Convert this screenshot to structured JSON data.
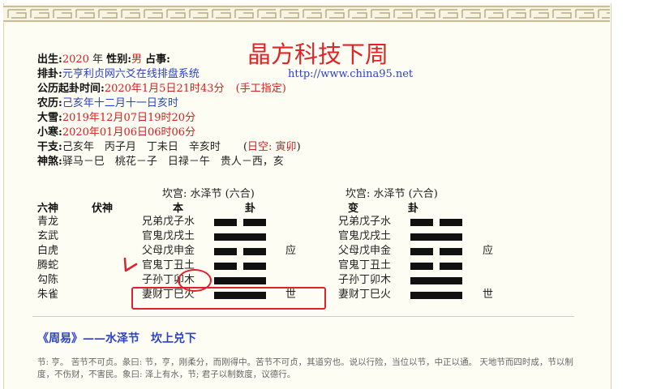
{
  "overlay_title": "晶方科技下周",
  "info": {
    "birth_label": "出生:",
    "birth_year": "2020",
    "year_unit": "年",
    "gender_label": "性别:",
    "gender": "男",
    "matter_label": "占事:",
    "paigua_label": "排卦:",
    "system_name": "元亨利贞网六爻在线排盘系统",
    "url": "http://www.china95.net",
    "time_label": "公历起卦时间:",
    "time_value": "2020年1月5日21时43分",
    "time_note": "(手工指定)",
    "lunar_label": "农历:",
    "lunar_value": "己亥年十二月十一日亥时",
    "daxue_label": "大雪:",
    "daxue_value": "2019年12月07日19时20分",
    "xiaohan_label": "小寒:",
    "xiaohan_value": "2020年01月06日06时06分",
    "ganzhi_label": "干支:",
    "ganzhi_value": "己亥年　丙子月　丁未日　辛亥时",
    "kong_open": "(",
    "kong_value": "日空: 寅卯",
    "kong_close": ")",
    "shensha_label": "神煞:",
    "shensha_value": "驿马－巳　桃花－子　日禄－午　贵人－西，亥"
  },
  "left_palace": "坎宫: 水泽节 (六合)",
  "right_palace": "坎宫: 水泽节 (六合)",
  "headers": {
    "liushen": "六神",
    "fushen": "伏神",
    "ben": "本",
    "gua": "卦",
    "bian": "变",
    "gua2": "卦"
  },
  "rows": [
    {
      "shen": "青龙",
      "yao": "兄弟戊子水",
      "bian_yao": "兄弟戊子水",
      "line": "yin",
      "bian_line": "yin",
      "mark": "",
      "bian_mark": ""
    },
    {
      "shen": "玄武",
      "yao": "官鬼戊戌土",
      "bian_yao": "官鬼戊戌土",
      "line": "yang",
      "bian_line": "yang",
      "mark": "",
      "bian_mark": ""
    },
    {
      "shen": "白虎",
      "yao": "父母戊申金",
      "bian_yao": "父母戊申金",
      "line": "yin",
      "bian_line": "yin",
      "mark": "应",
      "bian_mark": "应"
    },
    {
      "shen": "腾蛇",
      "yao": "官鬼丁丑土",
      "bian_yao": "官鬼丁丑土",
      "line": "yin",
      "bian_line": "yin",
      "mark": "",
      "bian_mark": ""
    },
    {
      "shen": "勾陈",
      "yao": "子孙丁卯木",
      "bian_yao": "子孙丁卯木",
      "line": "yang",
      "bian_line": "yang",
      "mark": "",
      "bian_mark": ""
    },
    {
      "shen": "朱雀",
      "yao": "妻财丁巳火",
      "bian_yao": "妻财丁巳火",
      "line": "yang",
      "bian_line": "yang",
      "mark": "世",
      "bian_mark": "世"
    }
  ],
  "zhouyi_title": "《周易》——水泽节　坎上兑下",
  "zhouyi_text": "节: 亨。 苦节不可贞。彖曰: 节，亨，刚柔分，而刚得中。苦节不可贞，其道穷也。说以行险，当位以节，中正以通。 天地节而四时成，节以制度，不伤财，不害民。象曰: 泽上有水，节; 君子以制数度，议德行。",
  "colors": {
    "label": "#111111",
    "value_red": "#d42020",
    "value_blue": "#2b41c8",
    "annotation": "#e0202a"
  }
}
